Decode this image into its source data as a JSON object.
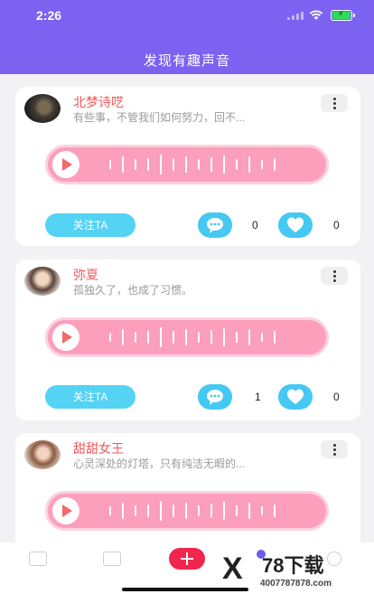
{
  "status_bar": {
    "time": "2:26"
  },
  "header": {
    "title": "发现有趣声音"
  },
  "posts": [
    {
      "name": "北梦诗呓",
      "desc": "有些事，不管我们如何努力，回不...",
      "follow_label": "关注TA",
      "comment_count": "0",
      "like_count": "0"
    },
    {
      "name": "弥夏",
      "desc": "孤独久了，也成了习惯。",
      "follow_label": "关注TA",
      "comment_count": "1",
      "like_count": "0"
    },
    {
      "name": "甜甜女王",
      "desc": "心灵深处的灯塔，只有纯洁无暇的..."
    }
  ],
  "tabbar": {
    "icons": [
      "home-icon",
      "gallery-icon",
      "add-icon",
      "messages-icon",
      "profile-icon"
    ]
  },
  "watermark": {
    "logo": "X",
    "text": "78下载",
    "url": "4007787878.com"
  },
  "colors": {
    "header": "#7b62f0",
    "player": "#fb9fbc",
    "accent": "#45c8f2",
    "name": "#ef5a5a"
  }
}
